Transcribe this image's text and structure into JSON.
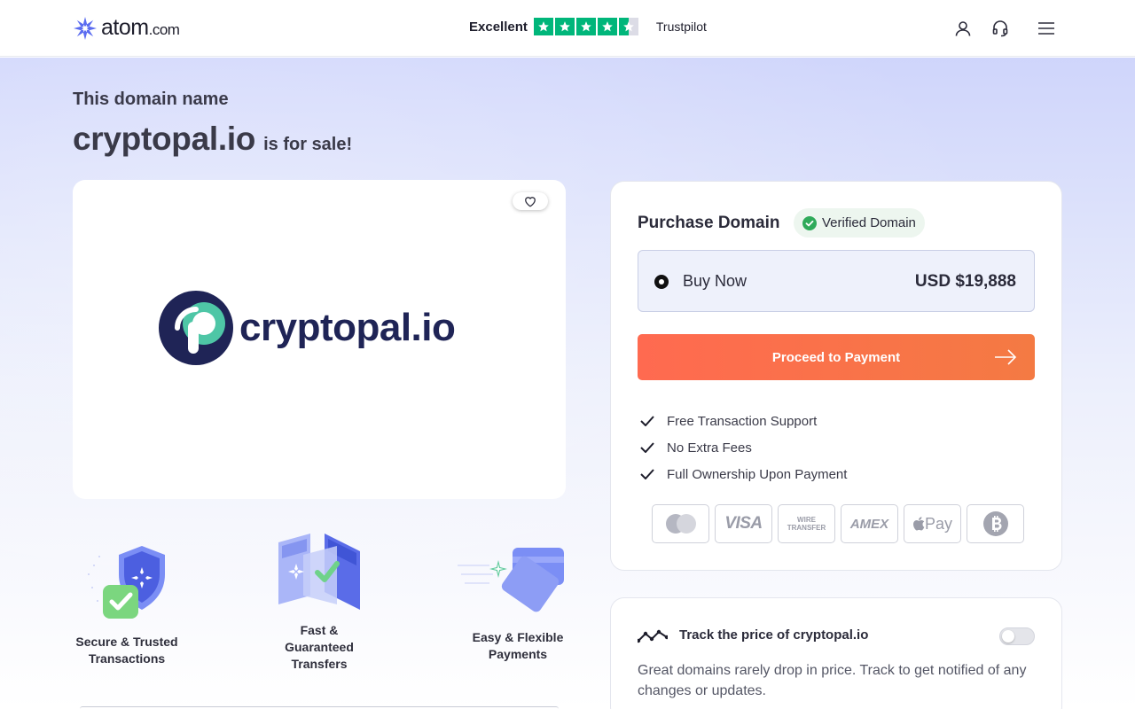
{
  "header": {
    "logo_text": "atom",
    "logo_suffix": ".com",
    "trust_label": "Excellent",
    "trust_stars": 4.5,
    "trust_brand": "Trustpilot",
    "icons": [
      "user-icon",
      "headset-icon",
      "menu-icon"
    ]
  },
  "hero": {
    "intro": "This domain name",
    "domain": "cryptopal.io",
    "for_sale": "is for sale!"
  },
  "logo_card": {
    "brand_text": "cryptopal.io",
    "favorite_icon": "heart-icon"
  },
  "features": [
    {
      "label": "Secure & Trusted Transactions",
      "icon": "shield-check-icon"
    },
    {
      "label": "Fast & Guaranteed Transfers",
      "icon": "transfer-icon"
    },
    {
      "label": "Easy & Flexible Payments",
      "icon": "card-icon"
    }
  ],
  "purchase": {
    "title": "Purchase Domain",
    "verified": "Verified Domain",
    "option_label": "Buy Now",
    "price": "USD $19,888",
    "cta": "Proceed to Payment",
    "benefits": [
      "Free Transaction Support",
      "No Extra Fees",
      "Full Ownership Upon Payment"
    ],
    "payment_methods": [
      "mastercard-icon",
      "visa-icon",
      "wire-transfer-icon",
      "amex-icon",
      "apple-pay-icon",
      "bitcoin-icon"
    ],
    "payment_labels": [
      "VISA",
      "WIRE TRANSFER",
      "AMEX",
      "Pay"
    ]
  },
  "track": {
    "title": "Track the price of cryptopal.io",
    "description": "Great domains rarely drop in price. Track to get notified of any changes or updates.",
    "enabled": false
  },
  "colors": {
    "accent": "#ff6a50",
    "trustpilot": "#00b67a",
    "brand_navy": "#1f2456",
    "brand_teal": "#4ec6a6",
    "logo_purple": "#5b6cf0"
  }
}
